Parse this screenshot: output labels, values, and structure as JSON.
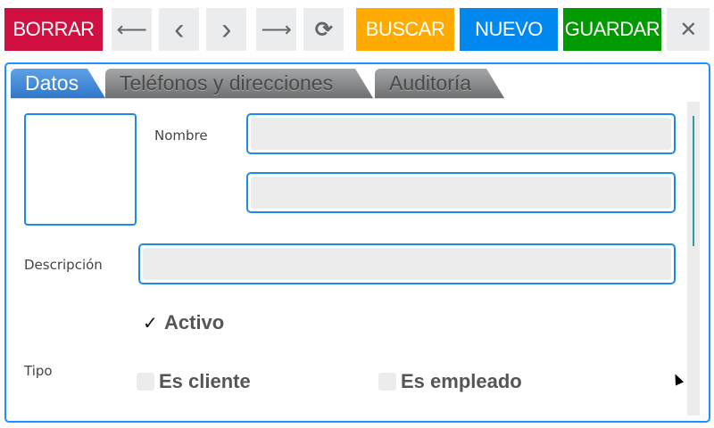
{
  "toolbar": {
    "delete_label": "BORRAR",
    "search_label": "BUSCAR",
    "new_label": "NUEVO",
    "save_label": "GUARDAR",
    "first_icon": "⟵",
    "prev_icon": "‹",
    "next_icon": "›",
    "last_icon": "⟶",
    "refresh_icon": "⟳",
    "close_icon": "✕",
    "colors": {
      "delete": "#cf1040",
      "search": "#ffaa00",
      "new": "#0088ee",
      "save": "#009900"
    }
  },
  "tabs": [
    {
      "label": "Datos",
      "active": true
    },
    {
      "label": "Teléfonos y direcciones",
      "active": false
    },
    {
      "label": "Auditoría",
      "active": false
    }
  ],
  "form": {
    "nombre_label": "Nombre",
    "nombre_value": "",
    "nombre2_value": "",
    "descripcion_label": "Descripción",
    "descripcion_value": "",
    "activo_label": "Activo",
    "activo_checked": true,
    "check_mark": "✓",
    "tipo_label": "Tipo",
    "es_cliente_label": "Es cliente",
    "es_cliente_checked": false,
    "es_empleado_label": "Es empleado",
    "es_empleado_checked": false
  }
}
